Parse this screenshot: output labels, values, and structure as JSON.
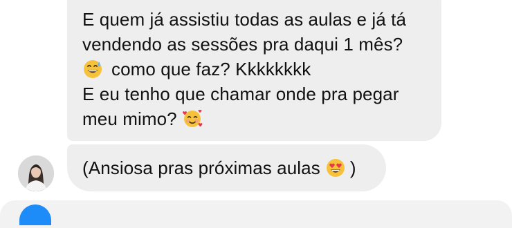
{
  "messages": [
    {
      "sender": "incoming",
      "lines": {
        "l1": "E quem já assistiu todas as aulas e já tá",
        "l2": "vendendo as sessões pra daqui 1 mês?",
        "l3": "como que faz? Kkkkkkkk",
        "l4": "E eu tenho que chamar onde pra pegar",
        "l5": "meu mimo?"
      },
      "emojis": [
        "grinning-sweat-emoji",
        "smiling-face-with-hearts-emoji"
      ]
    },
    {
      "sender": "incoming",
      "text_before": "(Ansiosa pras próximas aulas",
      "text_after": ")",
      "emojis": [
        "heart-eyes-emoji"
      ]
    }
  ],
  "colors": {
    "bubble_incoming": "#eeeeef",
    "text": "#111111",
    "accent": "#1d8cf8"
  }
}
